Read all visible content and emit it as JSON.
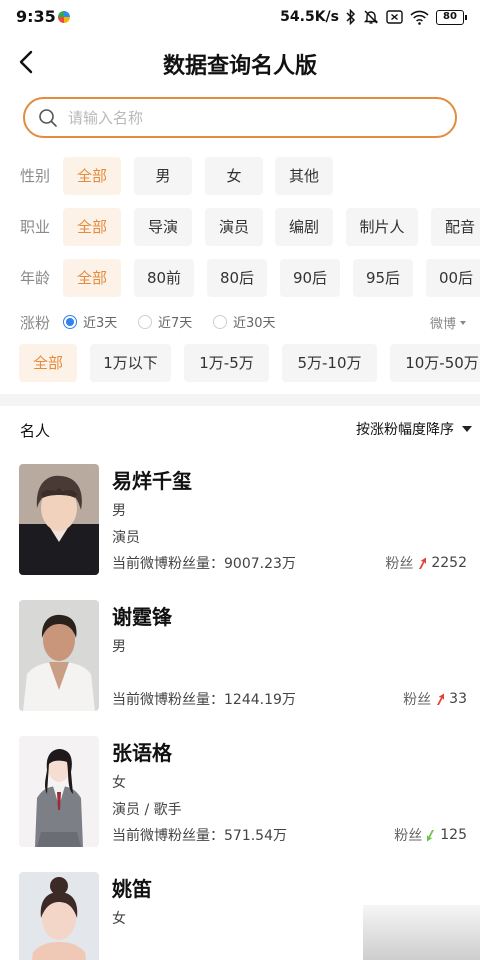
{
  "status_bar": {
    "time": "9:35",
    "network_speed": "54.5K/s",
    "battery": "80"
  },
  "header": {
    "title": "数据查询名人版"
  },
  "search": {
    "placeholder": "请输入名称",
    "value": ""
  },
  "filters": {
    "gender": {
      "label": "性别",
      "options": [
        "全部",
        "男",
        "女",
        "其他"
      ],
      "selected": "全部"
    },
    "occupation": {
      "label": "职业",
      "options": [
        "全部",
        "导演",
        "演员",
        "编剧",
        "制片人",
        "配音"
      ],
      "selected": "全部"
    },
    "age": {
      "label": "年龄",
      "options": [
        "全部",
        "80前",
        "80后",
        "90后",
        "95后",
        "00后"
      ],
      "selected": "全部"
    },
    "fan_growth": {
      "label": "涨粉",
      "periods": [
        "近3天",
        "近7天",
        "近30天"
      ],
      "selected_period": "近3天",
      "platform": "微博",
      "ranges": [
        "全部",
        "1万以下",
        "1万-5万",
        "5万-10万",
        "10万-50万"
      ],
      "selected_range": "全部"
    }
  },
  "list": {
    "header": "名人",
    "sort_label": "按涨粉幅度降序",
    "count_prefix": "当前微博粉丝量：",
    "fans_label": "粉丝",
    "items": [
      {
        "name": "易烊千玺",
        "gender": "男",
        "occupation": "演员",
        "fans_count": "9007.23万",
        "delta": "2252",
        "trend": "up"
      },
      {
        "name": "谢霆锋",
        "gender": "男",
        "occupation": "",
        "fans_count": "1244.19万",
        "delta": "33",
        "trend": "up"
      },
      {
        "name": "张语格",
        "gender": "女",
        "occupation": "演员 / 歌手",
        "fans_count": "571.54万",
        "delta": "125",
        "trend": "down"
      },
      {
        "name": "姚笛",
        "gender": "女",
        "occupation": "",
        "fans_count": "",
        "delta": "",
        "trend": ""
      }
    ]
  },
  "colors": {
    "accent": "#e58b3c",
    "accent_bg": "#fdf2e8",
    "radio_blue": "#2f82f0",
    "trend_up": "#e0413a",
    "trend_down": "#6cc24a"
  }
}
